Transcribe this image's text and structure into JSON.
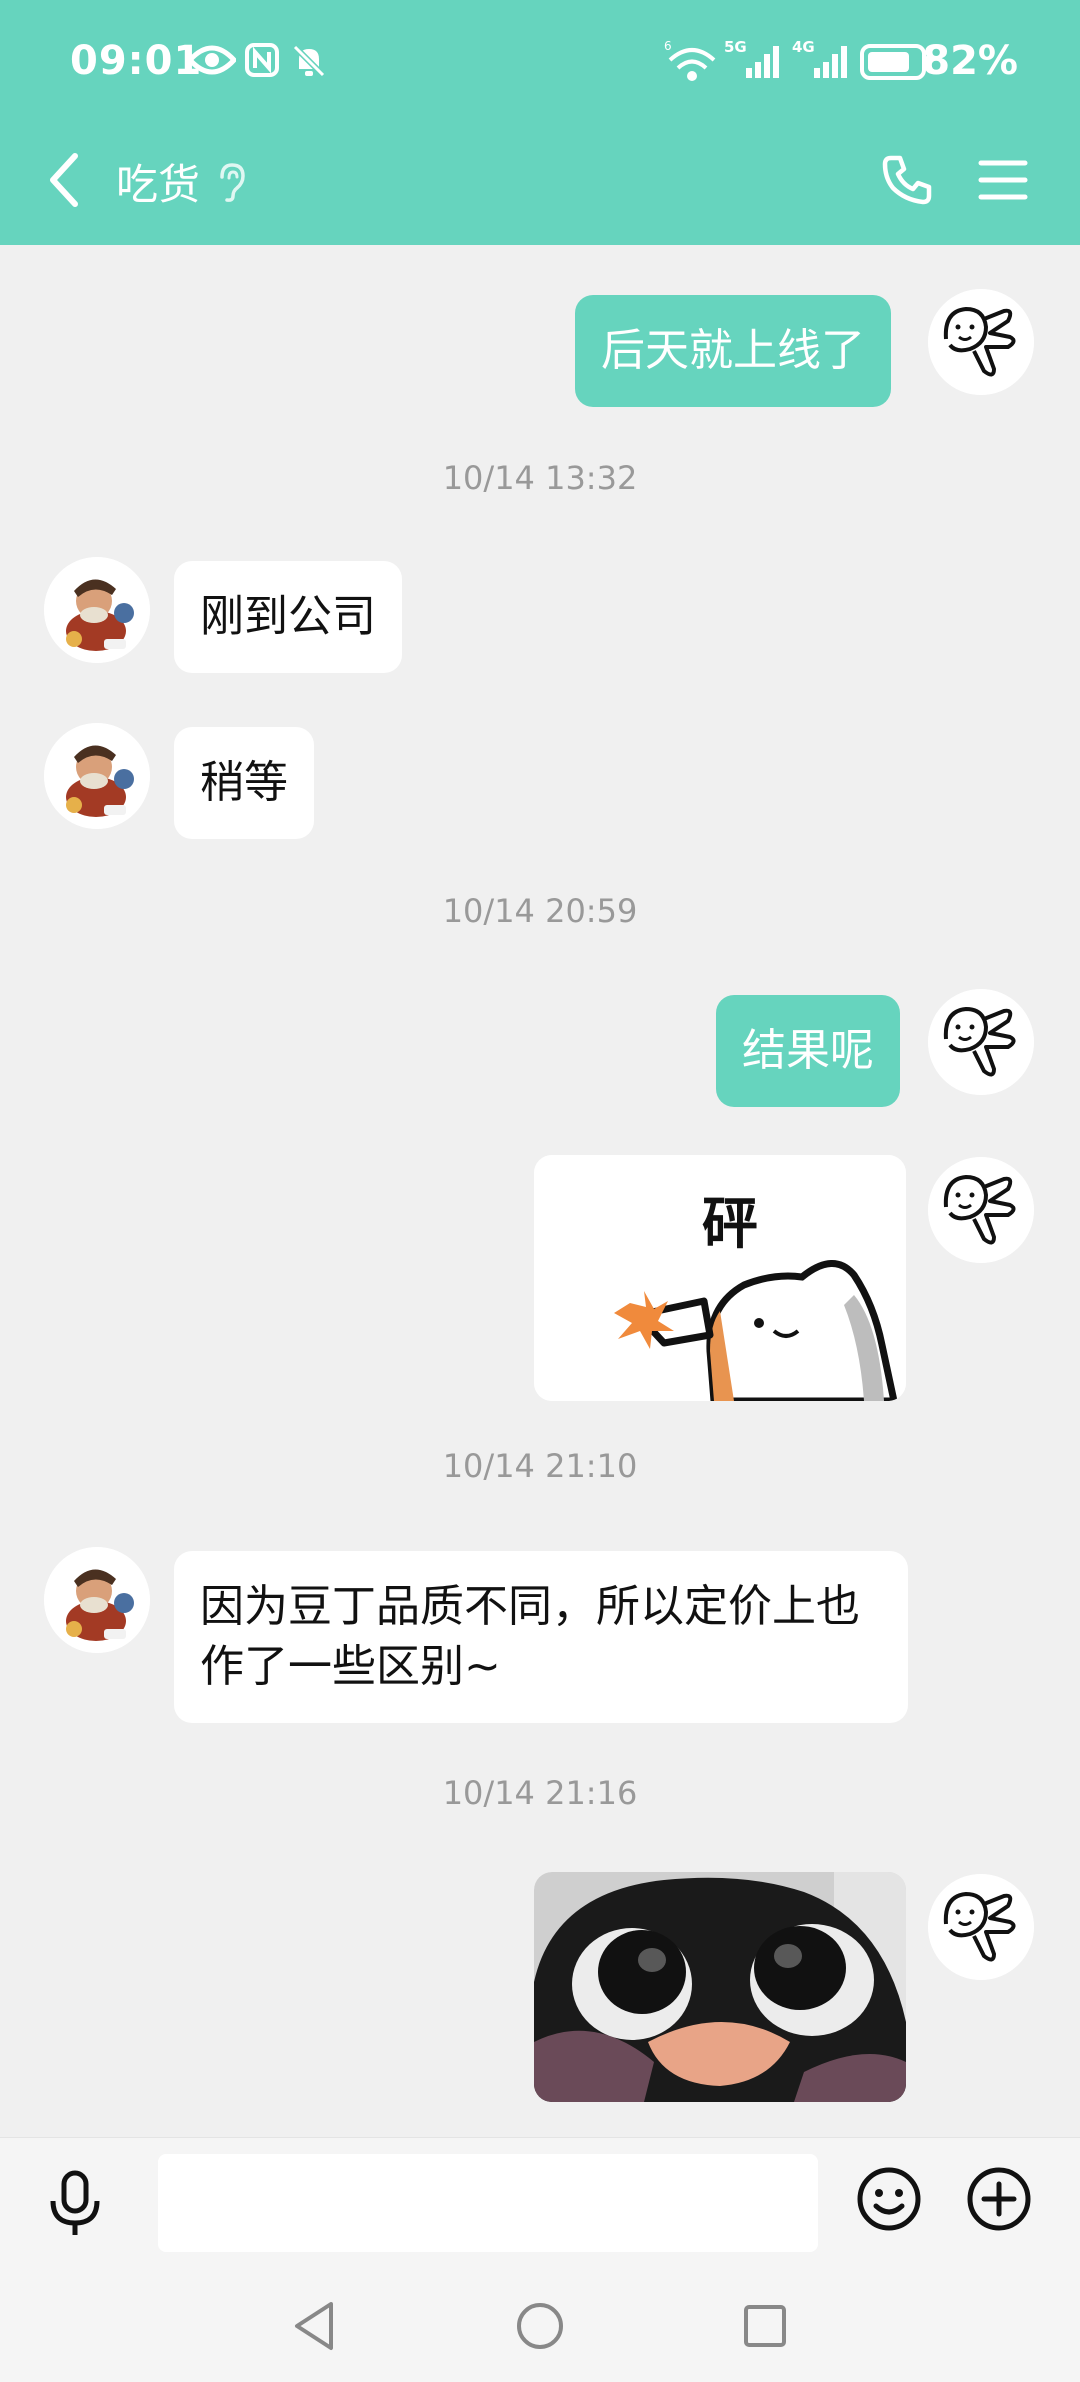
{
  "status_bar": {
    "time": "09:01",
    "battery_percent": "82%",
    "battery_level": 0.82,
    "network_5g": "5G",
    "network_4g": "4G",
    "wifi_badge": "6"
  },
  "header": {
    "title": "吃货"
  },
  "messages": [
    {
      "type": "text",
      "side": "sent",
      "text": "后天就上线了"
    },
    {
      "type": "timestamp",
      "text": "10/14 13:32"
    },
    {
      "type": "text",
      "side": "received",
      "text": "刚到公司"
    },
    {
      "type": "text",
      "side": "received",
      "text": "稍等"
    },
    {
      "type": "timestamp",
      "text": "10/14 20:59"
    },
    {
      "type": "text",
      "side": "sent",
      "text": "结果呢"
    },
    {
      "type": "sticker",
      "side": "sent",
      "caption": "砰"
    },
    {
      "type": "timestamp",
      "text": "10/14 21:10"
    },
    {
      "type": "text",
      "side": "received",
      "text": "因为豆丁品质不同，所以定价上也作了一些区别~"
    },
    {
      "type": "timestamp",
      "text": "10/14 21:16"
    },
    {
      "type": "sticker",
      "side": "sent",
      "caption": ""
    }
  ],
  "input": {
    "value": "",
    "placeholder": ""
  },
  "colors": {
    "accent": "#66d4be",
    "background": "#f0f0f0",
    "received_bubble": "#ffffff",
    "timestamp": "#999999"
  },
  "icons": {
    "back": "chevron-left-icon",
    "ear": "ear-icon",
    "phone": "phone-icon",
    "menu": "menu-icon",
    "mic": "microphone-icon",
    "emoji": "emoji-icon",
    "plus": "plus-circle-icon",
    "nav_back": "triangle-back-icon",
    "nav_home": "circle-home-icon",
    "nav_recent": "square-recent-icon"
  }
}
